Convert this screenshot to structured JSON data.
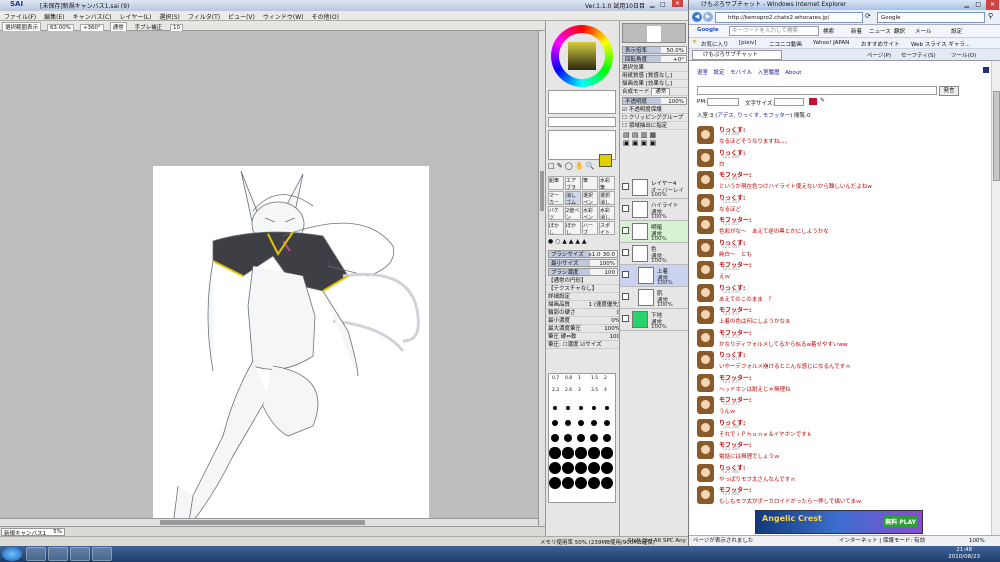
{
  "sai": {
    "logo": "SAI",
    "title": "[未保存]新規キャンバス1.sai (9)",
    "version": "Ver.1.1.0 試用10日目",
    "menu": [
      "ファイル(F)",
      "編集(E)",
      "キャンバス(C)",
      "レイヤー(L)",
      "選択(S)",
      "フィルタ(T)",
      "ビュー(V)",
      "ウィンドウ(W)",
      "その他(O)"
    ],
    "toolbar": [
      "選択範囲表示",
      "63.00%",
      "+360°",
      "通常",
      "手ブレ補正",
      "10"
    ],
    "nav": {
      "zoom": "表示倍率",
      "zoom_val": "50.0%",
      "angle": "回転角度",
      "angle_val": "+0°"
    },
    "color": {
      "primary": "#e0d000",
      "accent_red": "#ff0000",
      "wheel_inner": "#9b9320"
    },
    "layer_props": {
      "group_title": "選択効果",
      "fx1": "用紙質感",
      "fx1_val": "[質感なし]",
      "fx2": "描画効果",
      "fx2_val": "[効果なし]",
      "mode_label": "合成モード",
      "mode_val": "通常",
      "opacity_label": "不透明度",
      "opacity_val": "100%",
      "checks": [
        "不透明度保護",
        "クリッピンググループ",
        "領域抽出に指定"
      ]
    },
    "tools": {
      "buttons": [
        "鉛筆",
        "エアブラシ",
        "筆",
        "水彩筆",
        "マーカー",
        "消しゴム",
        "選択ペン",
        "選択消し",
        "バケツ",
        "2値ペン",
        "水彩ペン",
        "水彩消し",
        "ぼかし",
        "ぼかし",
        "ハーブ",
        "スポイト"
      ],
      "brush_size": "ブラシサイズ",
      "brush_size_mult": "x1.0",
      "brush_size_val": "30.0",
      "min_size": "最小サイズ",
      "min_size_val": "100%",
      "density": "ブラシ濃度",
      "density_val": "100",
      "shape": "【通常の円形】",
      "texture": "【テクスチャなし】",
      "detail": "詳細設定",
      "quality": "描画品質",
      "quality_val": "1 (速度優先)",
      "edge": "輪郭の硬さ",
      "edge_val": "0",
      "min_density": "最小濃度",
      "min_density_val": "0%",
      "max_density": "最大濃度筆圧",
      "max_density_val": "100%",
      "pressure": "筆圧 硬⇔軟",
      "pressure_val": "100",
      "pressure2": "筆圧:",
      "density_chk": "濃度",
      "size_chk": "サイズ"
    },
    "brush_labels": [
      "0.7",
      "0.8",
      "1",
      "1.5",
      "2",
      "2.3",
      "2.6",
      "3",
      "3.5",
      "4"
    ],
    "layers": [
      {
        "name": "レイヤー4",
        "mode": "オーバーレイ",
        "opacity": "100%"
      },
      {
        "name": "ハイライト",
        "mode": "通常",
        "opacity": "100%"
      },
      {
        "name": "明暗",
        "mode": "通常",
        "opacity": "100%"
      },
      {
        "name": "色",
        "mode": "通常",
        "opacity": "100%"
      },
      {
        "name": "上着",
        "mode": "通常",
        "opacity": "100%"
      },
      {
        "name": "肌",
        "mode": "通常",
        "opacity": "100%"
      },
      {
        "name": "下地",
        "mode": "通常",
        "opacity": "100%"
      }
    ],
    "doc_tab": "新規キャンバス1",
    "doc_tab_zoom": "5%",
    "status": "メモリ使用率 50% (239MB使用/900MB確保)",
    "status_keys": "Shift Ctrl Alt SPC Any"
  },
  "ie": {
    "title": "けもぷろサブチャット - Windows Internet Explorer",
    "url": "http://kemopro2.chatx2.whocares.jp/",
    "search": "Google",
    "google_placeholder": "キーワードを入力して検索",
    "google_btns": [
      "検索",
      "新着",
      "ニュース",
      "翻訳",
      "メール",
      "設定"
    ],
    "favorites": [
      "お気に入り",
      "[pixiv]",
      "ニコニコ動画",
      "Yahoo! JAPAN",
      "おすすめサイト",
      "Web スライス ギャラ..."
    ],
    "tab": "けもぷろサブチャット",
    "cmd": [
      "ページ(P)",
      "セーフティ(S)",
      "ツール(O)"
    ],
    "nav_links": [
      "退室",
      "設定",
      "モバイル",
      "入室履歴",
      "About"
    ],
    "speak_btn": "発言",
    "pm_label": "PM:",
    "font_label": "文字サイズ:",
    "room_info": "入室:3 (",
    "room_members": "アデス, りっくす, モフッター",
    "room_tail": ") 閲覧:0",
    "messages": [
      {
        "name": "りっくす:",
        "time": "(21:48)",
        "text": "なるほどそうなりますね。。。"
      },
      {
        "name": "りっくす:",
        "time": "(21:48)",
        "text": "白"
      },
      {
        "name": "モフッター:",
        "time": "(21:44)",
        "text": "というか現在色つけハイライト使えないから難しいんだよねw"
      },
      {
        "name": "りっくす:",
        "time": "(21:45)",
        "text": "なるほど"
      },
      {
        "name": "モフッター:",
        "time": "(21:45)",
        "text": "色彩がな～　あえて逆の黒とかにしようかな"
      },
      {
        "name": "りっくす:",
        "time": "(21:45)",
        "text": "純白～　とも"
      },
      {
        "name": "モフッター:",
        "time": "(21:45)",
        "text": "えｗ"
      },
      {
        "name": "りっくす:",
        "time": "(21:45)",
        "text": "あえてのこのまま　？"
      },
      {
        "name": "モフッター:",
        "time": "(21:47)",
        "text": "上着の色は何にしようかなぁ"
      },
      {
        "name": "モフッター:",
        "time": "(21:47)",
        "text": "かなりディフォルメしてるから似るw着せやすいww"
      },
      {
        "name": "りっくす:",
        "time": "(21:47)",
        "text": "いやーデフォルメ崩けるとこんな感じになるんですｎ"
      },
      {
        "name": "モフッター:",
        "time": "(21:47)",
        "text": "ヘッドホンは耐えじゃ無理ね"
      },
      {
        "name": "モフッター:",
        "time": "(21:47)",
        "text": "うんｗ"
      },
      {
        "name": "りっくす:",
        "time": "(21:48)",
        "text": "それでｉＰｈｏｎｅ＆イヤホンですｋ"
      },
      {
        "name": "モフッター:",
        "time": "(21:48)",
        "text": "電話には無理でしょうｗ"
      },
      {
        "name": "りっくす:",
        "time": "(21:48)",
        "text": "やっぱりモフ太さんなんですｎ"
      },
      {
        "name": "モフッター:",
        "time": "(21:48)",
        "text": "もしもモフ太がボーカロイドがったら一押しで描いてまｗ"
      }
    ],
    "ad_title": "Angelic Crest",
    "ad_sub": "無料 PLAY",
    "status": "ページが表示されました",
    "zone": "インターネット | 保護モード: 有効",
    "zoom": "100%"
  },
  "taskbar": {
    "time": "21:48",
    "date": "2010/08/23"
  }
}
